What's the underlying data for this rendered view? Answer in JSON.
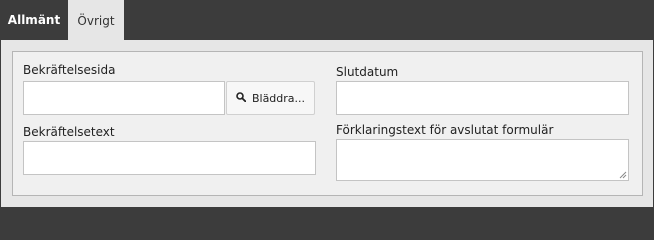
{
  "tabs": [
    {
      "label": "Allmänt"
    },
    {
      "label": "Övrigt"
    }
  ],
  "form": {
    "confirm_page": {
      "label": "Bekräftelsesida",
      "value": "",
      "browse_label": "Bläddra...",
      "browse_icon": "search-icon"
    },
    "confirm_text": {
      "label": "Bekräftelsetext",
      "value": ""
    },
    "end_date": {
      "label": "Slutdatum",
      "value": ""
    },
    "closed_text": {
      "label": "Förklaringstext för avslutat formulär",
      "value": ""
    }
  },
  "colors": {
    "tabbar": "#3c3c3c",
    "active_tab_text": "#ffffff",
    "inactive_tab_bg": "#e6e6e6",
    "panel_bg": "#f0f0f0",
    "panel_border": "#b5b5b5"
  }
}
